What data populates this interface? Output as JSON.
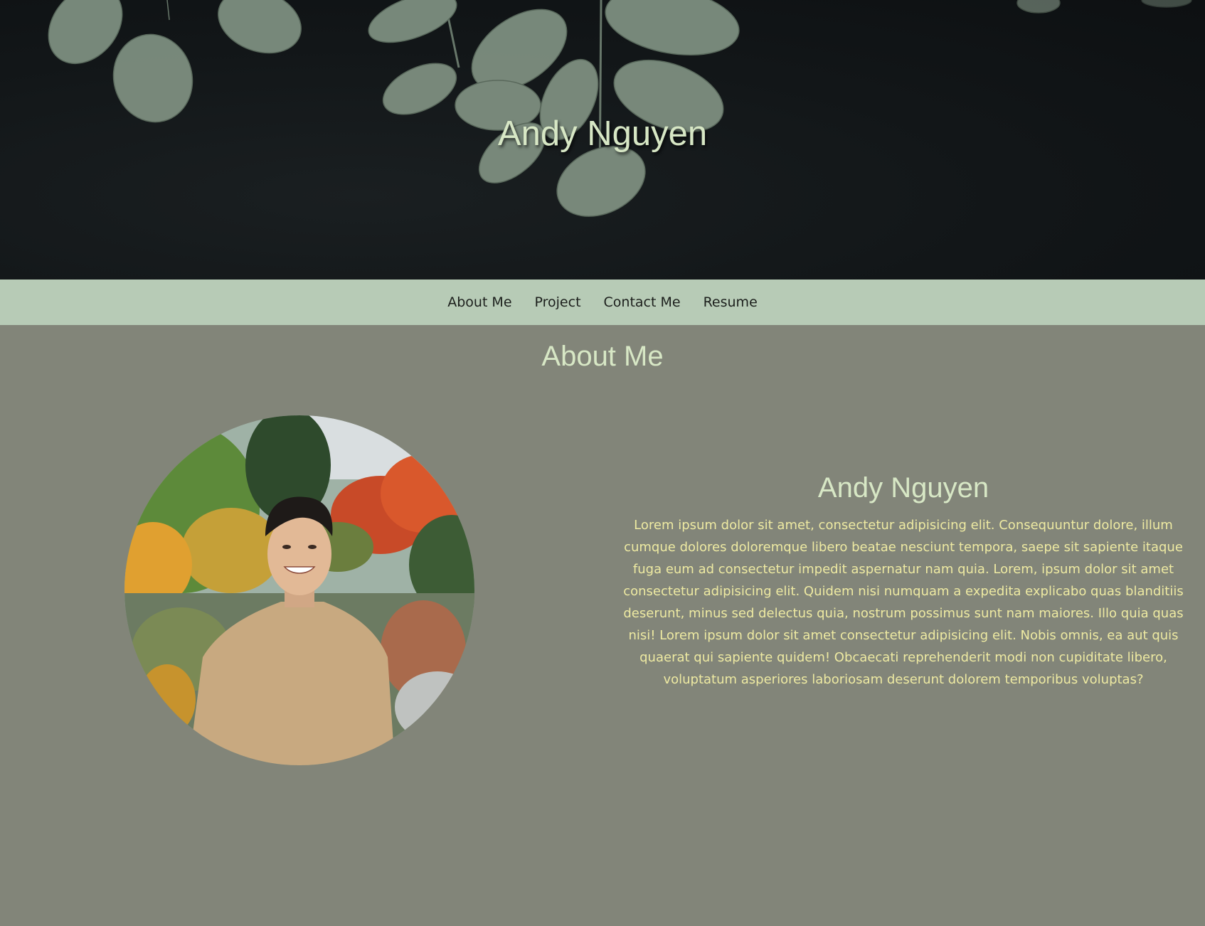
{
  "hero": {
    "title": "Andy Nguyen"
  },
  "nav": {
    "items": [
      {
        "label": "About Me"
      },
      {
        "label": "Project"
      },
      {
        "label": "Contact Me"
      },
      {
        "label": "Resume"
      }
    ]
  },
  "about": {
    "heading": "About Me",
    "name": "Andy Nguyen",
    "body": "Lorem ipsum dolor sit amet, consectetur adipisicing elit. Consequuntur dolore, illum cumque dolores doloremque libero beatae nesciunt tempora, saepe sit sapiente itaque fuga eum ad consectetur impedit aspernatur nam quia. Lorem, ipsum dolor sit amet consectetur adipisicing elit. Quidem nisi numquam a expedita explicabo quas blanditiis deserunt, minus sed delectus quia, nostrum possimus sunt nam maiores. Illo quia quas nisi! Lorem ipsum dolor sit amet consectetur adipisicing elit. Nobis omnis, ea aut quis quaerat qui sapiente quidem! Obcaecati reprehenderit modi non cupiditate libero, voluptatum asperiores laboriosam deserunt dolorem temporibus voluptas?"
  },
  "colors": {
    "hero_bg": "#121618",
    "nav_bg": "#b7cbb6",
    "page_bg": "#828579",
    "heading": "#d7e7c5",
    "body_text": "#eeeaa2"
  }
}
